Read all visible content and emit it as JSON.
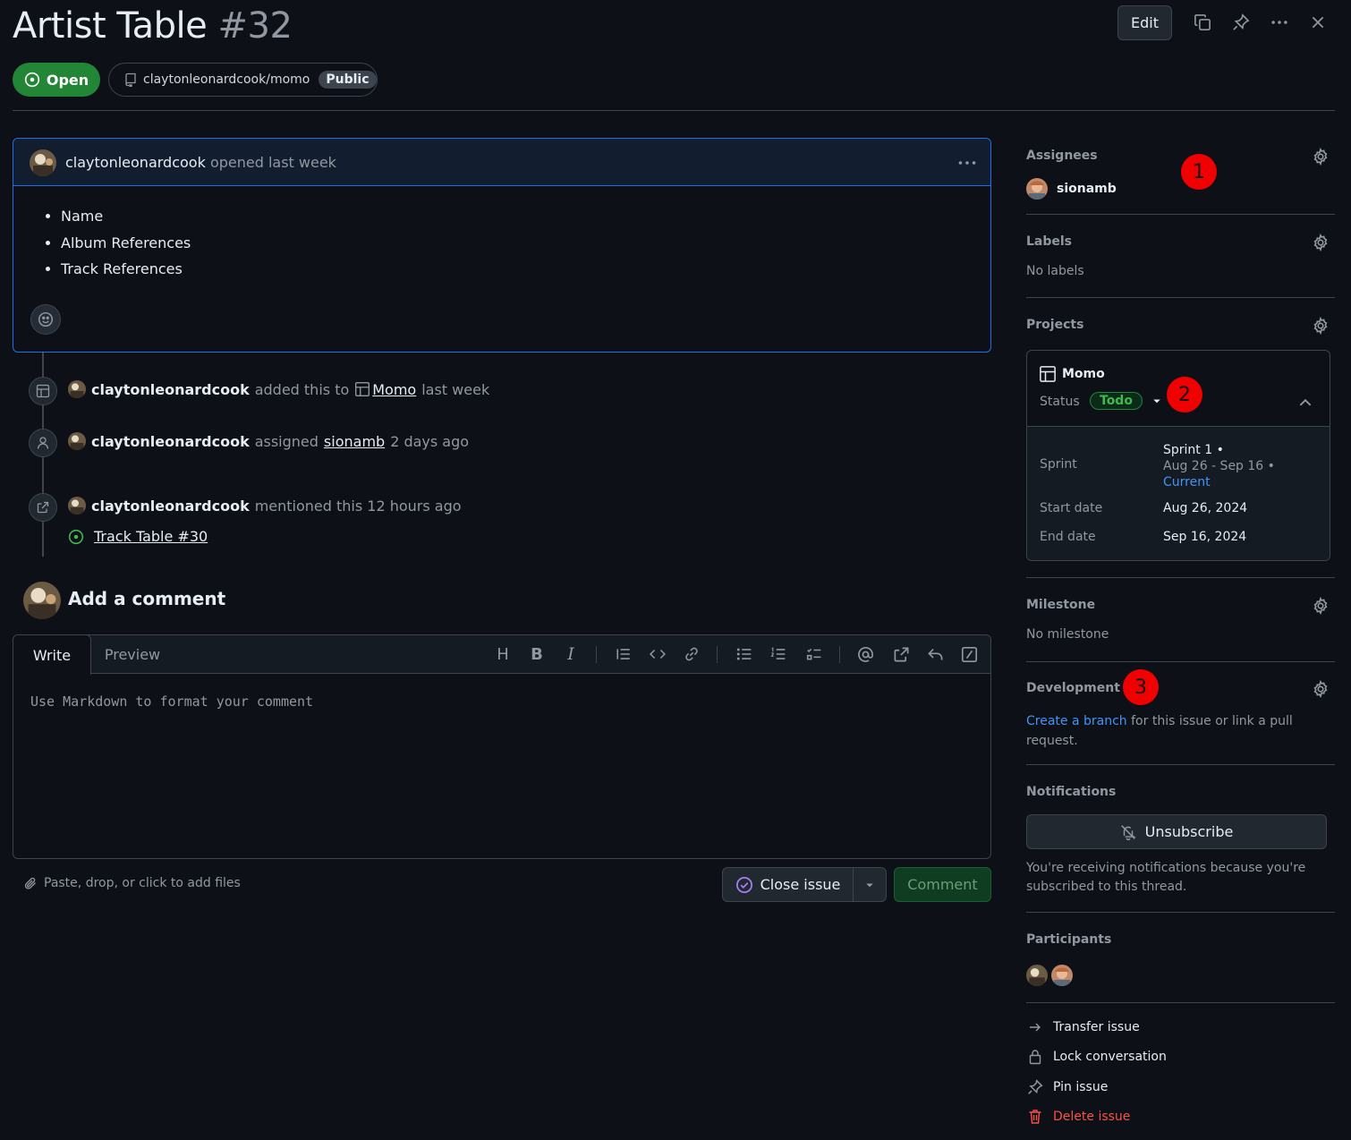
{
  "issue": {
    "title": "Artist Table",
    "number": "#32",
    "state": "Open",
    "repo": "claytonleonardcook/momo",
    "visibility": "Public"
  },
  "header_actions": {
    "edit_label": "Edit"
  },
  "comment": {
    "author": "claytonleonardcook",
    "meta": "opened last week",
    "items": [
      "Name",
      "Album References",
      "Track References"
    ]
  },
  "timeline": {
    "e1": {
      "actor": "claytonleonardcook",
      "text1": "added this to",
      "project": "Momo",
      "text2": "last week"
    },
    "e2": {
      "actor": "claytonleonardcook",
      "text1": "assigned",
      "user": "sionamb",
      "text2": "2 days ago"
    },
    "e3": {
      "actor": "claytonleonardcook",
      "text1": "mentioned this 12 hours ago",
      "ref": "Track Table #30"
    }
  },
  "add_comment": {
    "title": "Add a comment",
    "tab_write": "Write",
    "tab_preview": "Preview",
    "placeholder": "Use Markdown to format your comment",
    "files_hint": "Paste, drop, or click to add files",
    "close_label": "Close issue",
    "comment_label": "Comment"
  },
  "sidebar": {
    "assignees": {
      "heading": "Assignees",
      "user": "sionamb"
    },
    "labels": {
      "heading": "Labels",
      "empty": "No labels"
    },
    "projects": {
      "heading": "Projects",
      "name": "Momo",
      "status_label": "Status",
      "status_value": "Todo",
      "sprint_label": "Sprint",
      "sprint_line1": "Sprint 1 •",
      "sprint_line2": "Aug 26 - Sep 16 •",
      "sprint_current": "Current",
      "start_label": "Start date",
      "start_value": "Aug 26, 2024",
      "end_label": "End date",
      "end_value": "Sep 16, 2024"
    },
    "milestone": {
      "heading": "Milestone",
      "empty": "No milestone"
    },
    "development": {
      "heading": "Development",
      "link": "Create a branch",
      "text1": "for this issue or link a pull",
      "text2": "request."
    },
    "notifications": {
      "heading": "Notifications",
      "button": "Unsubscribe",
      "line1": "You're receiving notifications because you're",
      "line2": "subscribed to this thread."
    },
    "participants": {
      "heading": "Participants"
    },
    "actions": {
      "transfer": "Transfer issue",
      "lock": "Lock conversation",
      "pin": "Pin issue",
      "delete": "Delete issue"
    }
  },
  "markers": [
    "1",
    "2",
    "3"
  ],
  "colors": {
    "open_green": "#238636",
    "accent_blue": "#4493f8",
    "danger": "#f85149",
    "marker_red": "#f00000"
  }
}
